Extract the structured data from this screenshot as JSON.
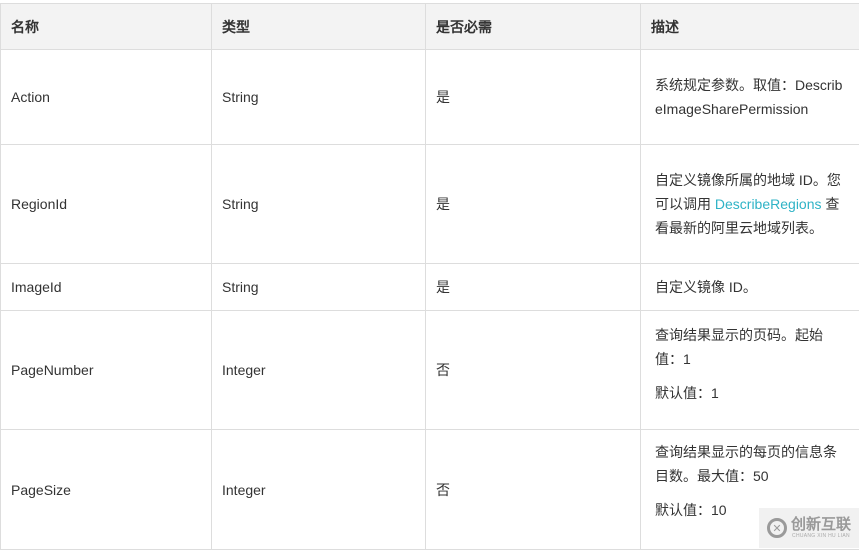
{
  "table": {
    "headers": [
      "名称",
      "类型",
      "是否必需",
      "描述"
    ],
    "rows": [
      {
        "name": "Action",
        "type": "String",
        "required": "是",
        "desc": {
          "text": "系统规定参数。取值：DescribeImageSharePermission"
        }
      },
      {
        "name": "RegionId",
        "type": "String",
        "required": "是",
        "desc": {
          "before": "自定义镜像所属的地域 ID。您可以调用 ",
          "link": "DescribeRegions",
          "after": " 查看最新的阿里云地域列表。"
        }
      },
      {
        "name": "ImageId",
        "type": "String",
        "required": "是",
        "desc": {
          "text": "自定义镜像 ID。"
        }
      },
      {
        "name": "PageNumber",
        "type": "Integer",
        "required": "否",
        "desc": {
          "text": "查询结果显示的页码。起始值：1",
          "default": "默认值：1"
        }
      },
      {
        "name": "PageSize",
        "type": "Integer",
        "required": "否",
        "desc": {
          "text": "查询结果显示的每页的信息条目数。最大值：50",
          "default": "默认值：10"
        }
      }
    ]
  },
  "colors": {
    "link": "#2fb3c6",
    "header_bg": "#f3f3f3",
    "border": "#dddddd"
  },
  "watermark": {
    "logo_icon": "cx-logo-icon",
    "text_cn": "创新互联",
    "text_en": "CHUANG XIN HU LIAN"
  }
}
